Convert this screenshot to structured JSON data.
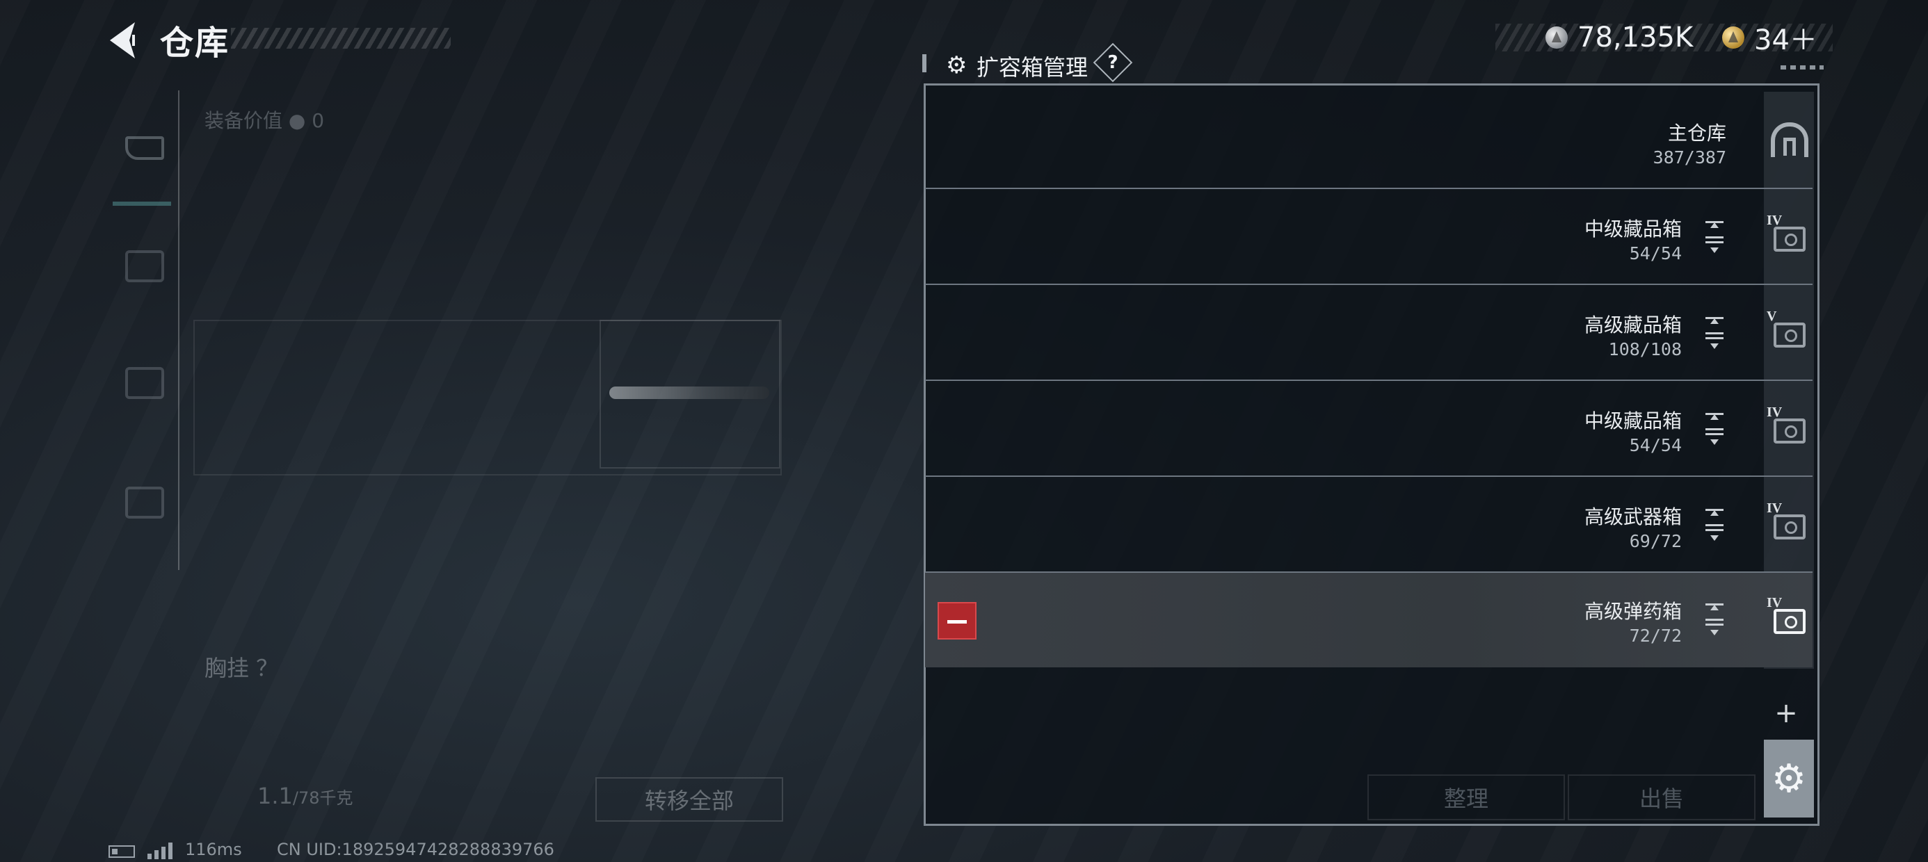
{
  "header": {
    "title": "仓库",
    "back_icon": "back-arrow-icon"
  },
  "currency": {
    "silver": "78,135K",
    "gold": "34＋"
  },
  "left_panel": {
    "equipment_value_label": "装备价值",
    "equipment_value": "0",
    "chest_rig_label": "胸挂  ？",
    "capacity": "1.1",
    "capacity_max": "/78千克",
    "transfer_all": "转移全部"
  },
  "manager": {
    "title": "扩容箱管理",
    "help": "?",
    "containers": [
      {
        "name": "主仓库",
        "capacity": "387/387",
        "level": "",
        "kind": "main"
      },
      {
        "name": "中级藏品箱",
        "capacity": "54/54",
        "level": "IV"
      },
      {
        "name": "高级藏品箱",
        "capacity": "108/108",
        "level": "V"
      },
      {
        "name": "中级藏品箱",
        "capacity": "54/54",
        "level": "IV"
      },
      {
        "name": "高级武器箱",
        "capacity": "69/72",
        "level": "IV"
      },
      {
        "name": "高级弹药箱",
        "capacity": "72/72",
        "level": "IV",
        "selected": true
      }
    ],
    "add": "+",
    "sort": "整理",
    "sell": "出售"
  },
  "status": {
    "ping": "116ms",
    "uid": "CN UID:18925947428288839766"
  },
  "colors": {
    "remove": "#b0282c",
    "panel_border": "#7e8790"
  }
}
